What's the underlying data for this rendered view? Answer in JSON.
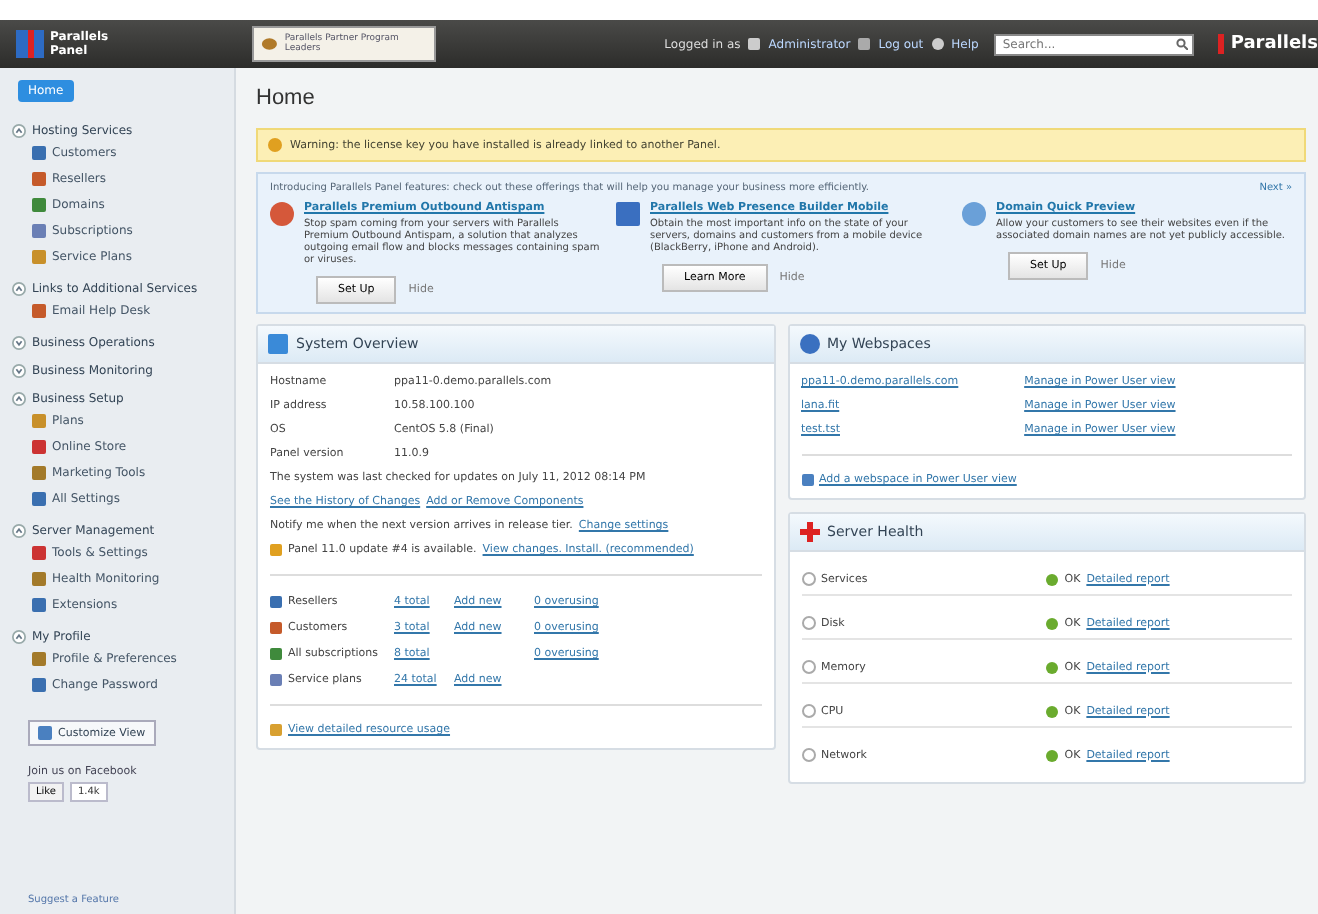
{
  "header": {
    "logo": "Parallels Panel",
    "banner": "Parallels Partner Program Leaders",
    "logged_in_label": "Logged in as",
    "user": "Administrator",
    "logout": "Log out",
    "help": "Help",
    "search": {
      "placeholder": "Search..."
    },
    "brand": "Parallels"
  },
  "sidebar": {
    "home_button": "Home",
    "groups": [
      {
        "title": "Hosting Services",
        "expanded": true,
        "items": [
          "Customers",
          "Resellers",
          "Domains",
          "Subscriptions",
          "Service Plans"
        ]
      },
      {
        "title": "Links to Additional Services",
        "expanded": true,
        "items": [
          "Email Help Desk"
        ]
      },
      {
        "title": "Business Operations",
        "expanded": false
      },
      {
        "title": "Business Monitoring",
        "expanded": false
      },
      {
        "title": "Business Setup",
        "expanded": true,
        "items": [
          "Plans",
          "Online Store",
          "Marketing Tools",
          "All Settings"
        ]
      },
      {
        "title": "Server Management",
        "expanded": true,
        "items": [
          "Tools & Settings",
          "Health Monitoring",
          "Extensions"
        ]
      },
      {
        "title": "My Profile",
        "expanded": true,
        "items": [
          "Profile & Preferences",
          "Change Password"
        ]
      }
    ],
    "view_button": "Customize View",
    "facebook": "Join us on Facebook",
    "like": "Like",
    "like_count": "1.4k",
    "footer": "Suggest a Feature"
  },
  "main": {
    "title": "Home",
    "warning": "Warning: the license key you have installed is already linked to another Panel.",
    "promo": {
      "intro": "Introducing Parallels Panel features: check out these offerings that will help you manage your business more efficiently.",
      "next": "Next »",
      "items": [
        {
          "title": "Parallels Premium Outbound Antispam",
          "text": "Stop spam coming from your servers with Parallels Premium Outbound Antispam, a solution that analyzes outgoing email flow and blocks messages containing spam or viruses.",
          "button": "Set Up",
          "hide": "Hide"
        },
        {
          "title": "Parallels Web Presence Builder Mobile",
          "text": "Obtain the most important info on the state of your servers, domains and customers from a mobile device (BlackBerry, iPhone and Android).",
          "button": "Learn More",
          "hide": "Hide"
        },
        {
          "title": "Domain Quick Preview",
          "text": "Allow your customers to see their websites even if the associated domain names are not yet publicly accessible.",
          "button": "Set Up",
          "hide": "Hide"
        }
      ]
    },
    "overview": {
      "title": "System Overview",
      "facts": [
        {
          "label": "Hostname",
          "value": "ppa11-0.demo.parallels.com"
        },
        {
          "label": "IP address",
          "value": "10.58.100.100"
        },
        {
          "label": "OS",
          "value": "CentOS 5.8 (Final)"
        },
        {
          "label": "Panel version",
          "value": "11.0.9"
        }
      ],
      "checked": "The system was last checked for updates on July 11, 2012 08:14 PM",
      "history_link": "See the History of Changes",
      "components_link": "Add or Remove Components",
      "notify": "Notify me when the next version arrives in release tier.",
      "notify_link": "Change settings",
      "update": "Panel 11.0 update #4 is available.",
      "update_link": "View changes. Install. (recommended)",
      "stats": [
        {
          "label": "Resellers",
          "total": "4 total",
          "add": "Add new",
          "over": "0 overusing"
        },
        {
          "label": "Customers",
          "total": "3 total",
          "add": "Add new",
          "over": "0 overusing"
        },
        {
          "label": "All subscriptions",
          "total": "8 total",
          "over": "0 overusing"
        },
        {
          "label": "Service plans",
          "total": "24 total",
          "add": "Add new"
        }
      ],
      "usage_link": "View detailed resource usage"
    },
    "webspaces": {
      "title": "My Webspaces",
      "rows": [
        {
          "name": "ppa11-0.demo.parallels.com",
          "action": "Manage in Power User view"
        },
        {
          "name": "lana.fit",
          "action": "Manage in Power User view"
        },
        {
          "name": "test.tst",
          "action": "Manage in Power User view"
        }
      ],
      "add_link": "Add a webspace in Power User view"
    },
    "health": {
      "title": "Server Health",
      "rows": [
        {
          "name": "Services",
          "status": "OK",
          "link": "Detailed report"
        },
        {
          "name": "Disk",
          "status": "OK",
          "link": "Detailed report"
        },
        {
          "name": "Memory",
          "status": "OK",
          "link": "Detailed report"
        },
        {
          "name": "CPU",
          "status": "OK",
          "link": "Detailed report"
        },
        {
          "name": "Network",
          "status": "OK",
          "link": "Detailed report"
        }
      ]
    }
  }
}
